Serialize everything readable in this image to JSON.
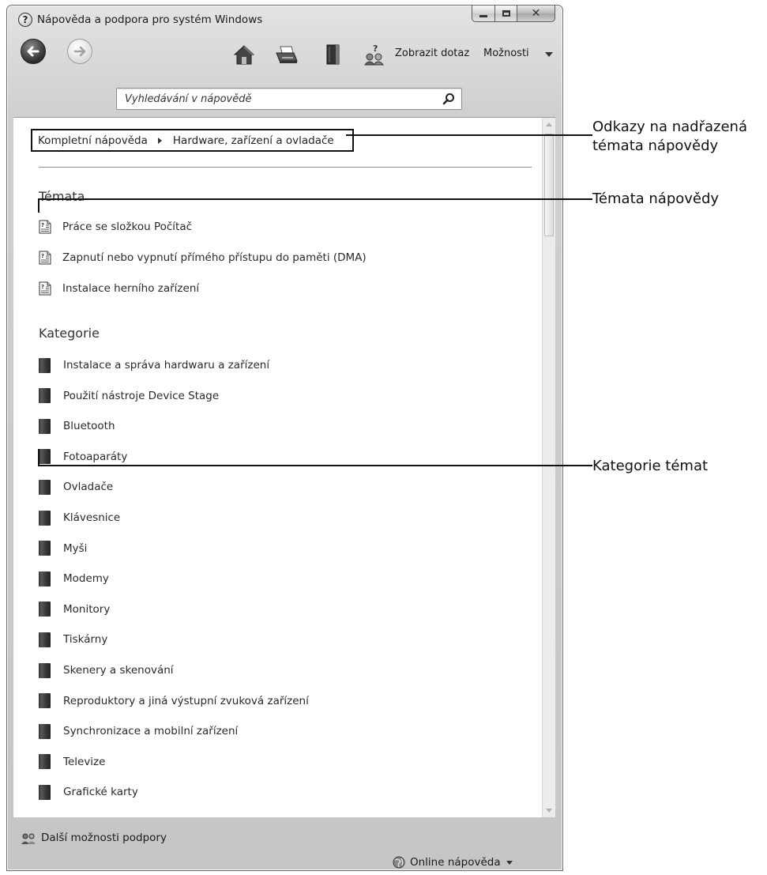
{
  "window": {
    "title": "Nápověda a podpora pro systém Windows",
    "help_glyph": "?"
  },
  "toolbar": {
    "ask_label": "Zobrazit dotaz",
    "options_label": "Možnosti"
  },
  "search": {
    "placeholder": "Vyhledávání v nápovědě"
  },
  "breadcrumb": {
    "items": [
      "Kompletní nápověda",
      "Hardware, zařízení a ovladače"
    ]
  },
  "topics": {
    "heading": "Témata",
    "items": [
      "Práce se složkou Počítač",
      "Zapnutí nebo vypnutí přímého přístupu do paměti (DMA)",
      "Instalace herního zařízení"
    ]
  },
  "categories": {
    "heading": "Kategorie",
    "items": [
      "Instalace a správa hardwaru a zařízení",
      "Použití nástroje Device Stage",
      "Bluetooth",
      "Fotoaparáty",
      "Ovladače",
      "Klávesnice",
      "Myši",
      "Modemy",
      "Monitory",
      "Tiskárny",
      "Skenery a skenování",
      "Reproduktory a jiná výstupní zvuková zařízení",
      "Synchronizace a mobilní zařízení",
      "Televize",
      "Grafické karty"
    ]
  },
  "footer": {
    "support_label": "Další možnosti podpory",
    "online_label": "Online nápověda"
  },
  "callouts": {
    "breadcrumb_line1": "Odkazy na nadřazená",
    "breadcrumb_line2": "témata nápovědy",
    "topics": "Témata nápovědy",
    "categories": "Kategorie témat"
  },
  "icons": [
    "help-icon",
    "back-icon",
    "forward-icon",
    "home-icon",
    "print-icon",
    "browse-help-icon",
    "ask-icon",
    "search-icon",
    "topic-icon",
    "book-icon",
    "support-icon",
    "globe-icon"
  ]
}
